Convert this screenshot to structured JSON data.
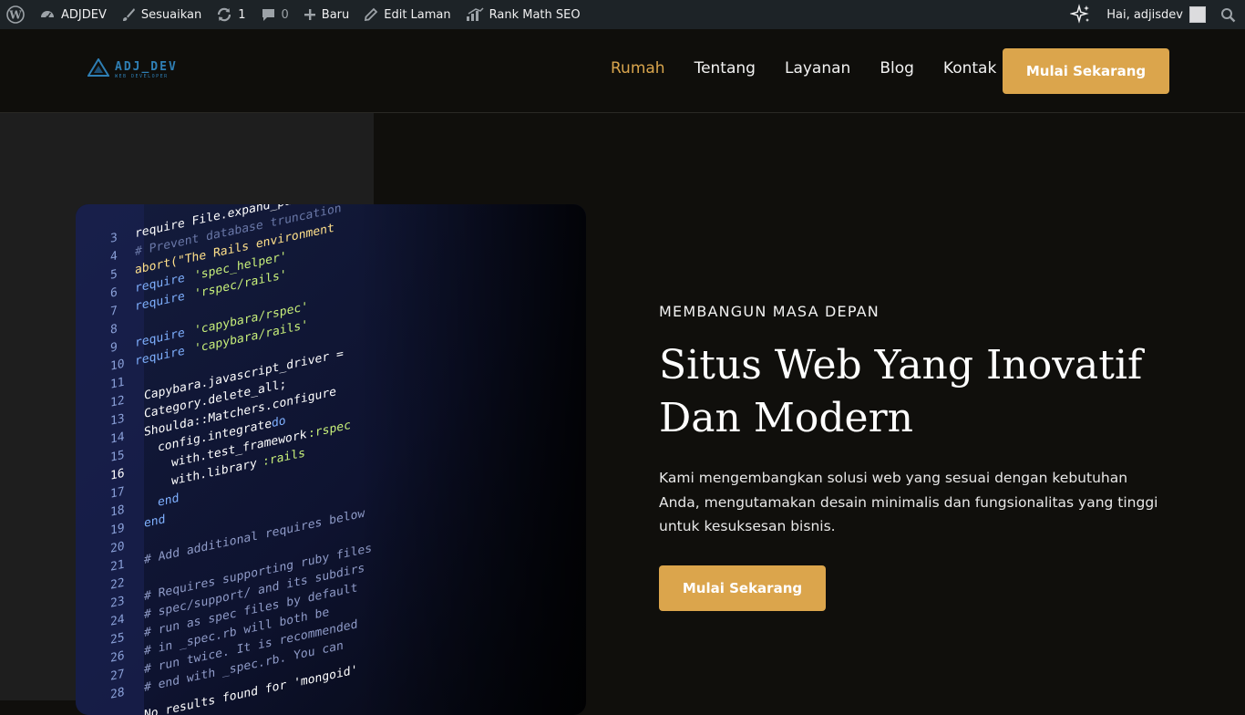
{
  "adminbar": {
    "items": [
      {
        "icon": "wordpress-logo-icon",
        "label": ""
      },
      {
        "icon": "dashboard-icon",
        "label": "ADJDEV"
      },
      {
        "icon": "brush-icon",
        "label": "Sesuaikan"
      },
      {
        "icon": "updates-icon",
        "label": "1"
      },
      {
        "icon": "comment-icon",
        "label": "0"
      },
      {
        "icon": "plus-icon",
        "label": "Baru"
      },
      {
        "icon": "pencil-icon",
        "label": "Edit Laman"
      },
      {
        "icon": "rank-math-icon",
        "label": "Rank Math SEO"
      }
    ],
    "greeting": "Hai, adjisdev"
  },
  "header": {
    "logo_main": "ADJ_DEV",
    "logo_sub": "WEB DEVELOPER",
    "nav": [
      "Rumah",
      "Tentang",
      "Layanan",
      "Blog",
      "Kontak"
    ],
    "active_nav": "Rumah",
    "cta": "Mulai Sekarang"
  },
  "hero": {
    "eyebrow": "MEMBANGUN MASA DEPAN",
    "headline_line1": "Situs Web Yang Inovatif",
    "headline_line2": "Dan Modern",
    "description": "Kami mengembangkan solusi web yang sesuai dengan kebutuhan Anda, mengutamakan desain minimalis dan fungsionalitas yang tinggi untuk kesuksesan bisnis.",
    "cta": "Mulai Sekarang"
  },
  "colors": {
    "accent": "#dba54c",
    "background": "#100f0c",
    "adminbar": "#1d2327",
    "logo": "#2f7fb5"
  }
}
